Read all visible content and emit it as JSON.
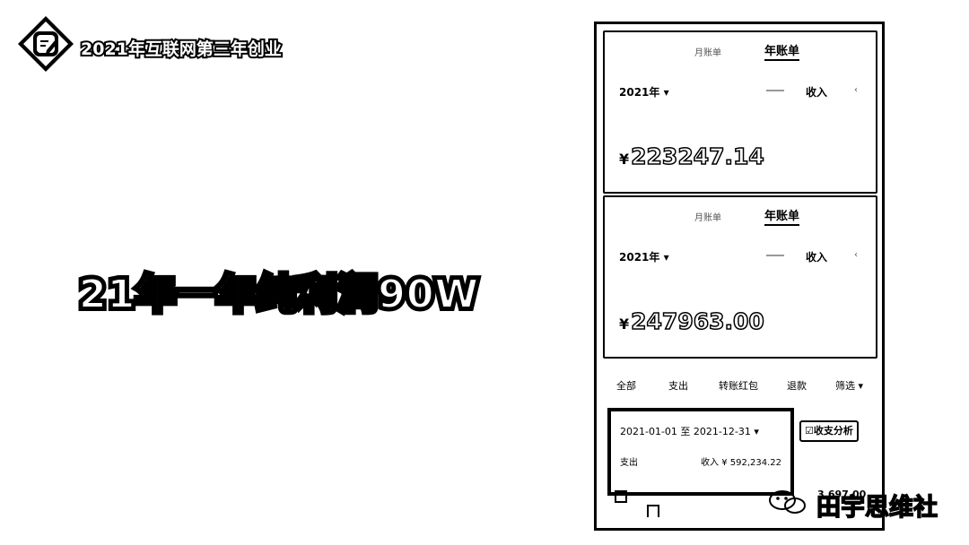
{
  "header": {
    "title": "2021年互联网第三年创业"
  },
  "headline": "21年一年纯利润90W",
  "phone": {
    "cards": [
      {
        "tab_month": "月账单",
        "tab_year": "年账单",
        "year_select": "2021年",
        "type_select": "收入",
        "sub_label": "",
        "amount": "223247.14"
      },
      {
        "tab_month": "月账单",
        "tab_year": "年账单",
        "year_select": "2021年",
        "type_select": "收入",
        "sub_label": "",
        "amount": "247963.00"
      }
    ],
    "currency_symbol": "¥",
    "filters": [
      "全部",
      "支出",
      "转账红包",
      "退款",
      "筛选"
    ],
    "summary": {
      "date_range": "2021-01-01 至 2021-12-31",
      "spend_label": "支出",
      "income": "收入 ¥ 592,234.22"
    },
    "analysis_button": "收支分析",
    "bottom_number": "3,697.00"
  },
  "watermark": {
    "text": "田宇思维社"
  },
  "colors": {
    "background": "#ffffff",
    "ink": "#000000"
  },
  "icons": {
    "logo": "edit-note-icon",
    "dropdown": "chevron-down-icon",
    "analysis": "chart-icon",
    "watermark": "wechat-icon"
  }
}
